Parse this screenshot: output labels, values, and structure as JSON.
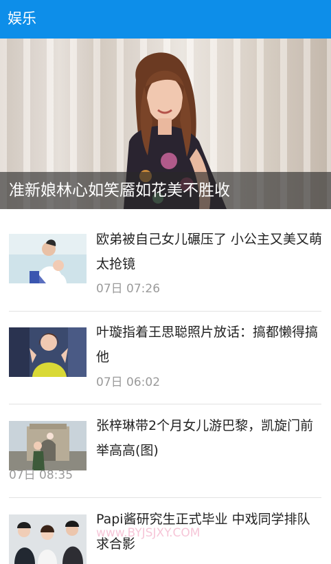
{
  "header": {
    "title": "娱乐",
    "background": "#0d8ee9"
  },
  "hero": {
    "caption": "准新娘林心如笑靥如花美不胜收",
    "image_icon": "photo-woman-floral-dress"
  },
  "news": [
    {
      "title": "欧弟被自己女儿碾压了 小公主又美又萌太抢镜",
      "time": "07日 07:26"
    },
    {
      "title": "叶璇指着王思聪照片放话：搞都懒得搞他",
      "time": "07日 06:02"
    },
    {
      "title": "张梓琳带2个月女儿游巴黎，凯旋门前举高高(图)",
      "time": "07日 08:35"
    },
    {
      "title": "Papi酱研究生正式毕业 中戏同学排队求合影",
      "time": ""
    }
  ],
  "watermark": "www.BYJSJXY.COM"
}
